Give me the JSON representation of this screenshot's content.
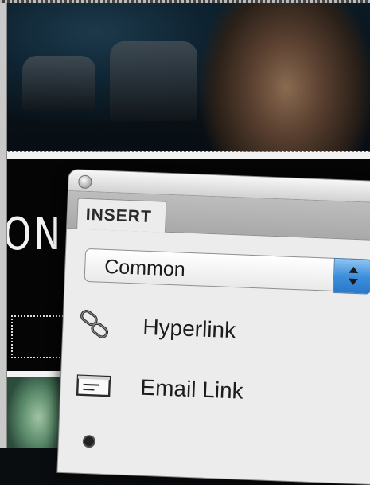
{
  "panel": {
    "tab_label": "INSERT",
    "category": {
      "selected": "Common"
    },
    "items": [
      {
        "label": "Hyperlink",
        "icon": "hyperlink-chain-icon"
      },
      {
        "label": "Email Link",
        "icon": "email-link-icon"
      }
    ]
  },
  "background": {
    "title_fragment": "ON+"
  },
  "colors": {
    "panel_bg": "#ececec",
    "select_accent": "#3d8fdc",
    "tab_strip": "#b3b3b3"
  }
}
